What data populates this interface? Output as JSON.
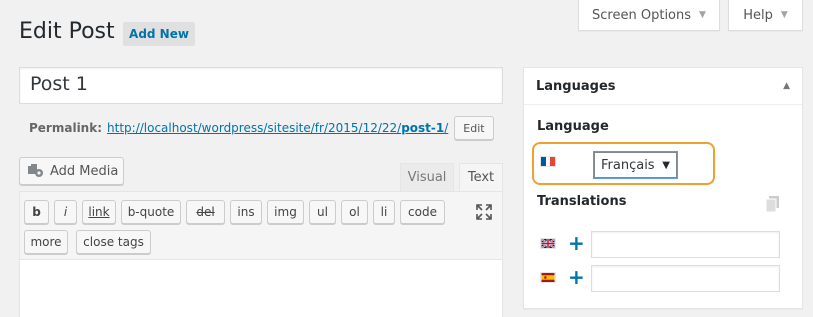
{
  "screen_meta": {
    "screen_options_label": "Screen Options",
    "help_label": "Help"
  },
  "page": {
    "title": "Edit Post",
    "add_new_label": "Add New"
  },
  "post": {
    "title_value": "Post 1"
  },
  "permalink": {
    "label": "Permalink:",
    "url_base": "http://localhost/wordpress/sitesite/fr/2015/12/22/",
    "url_slug": "post-1",
    "url_trailing": "/",
    "edit_label": "Edit"
  },
  "editor": {
    "add_media_label": "Add Media",
    "tabs": {
      "visual": "Visual",
      "text": "Text"
    },
    "quicktags": [
      "b",
      "i",
      "link",
      "b-quote",
      "del",
      "ins",
      "img",
      "ul",
      "ol",
      "li",
      "code",
      "more",
      "close tags"
    ]
  },
  "languages_box": {
    "title": "Languages",
    "language_label": "Language",
    "selected_language": "Français",
    "selected_flag": "flag-fr-icon",
    "translations_label": "Translations",
    "translations": [
      {
        "flag": "flag-gb-icon",
        "value": ""
      },
      {
        "flag": "flag-es-icon",
        "value": ""
      }
    ]
  },
  "colors": {
    "link": "#0073aa",
    "highlight": "#f0a030",
    "background": "#f1f1f1"
  }
}
